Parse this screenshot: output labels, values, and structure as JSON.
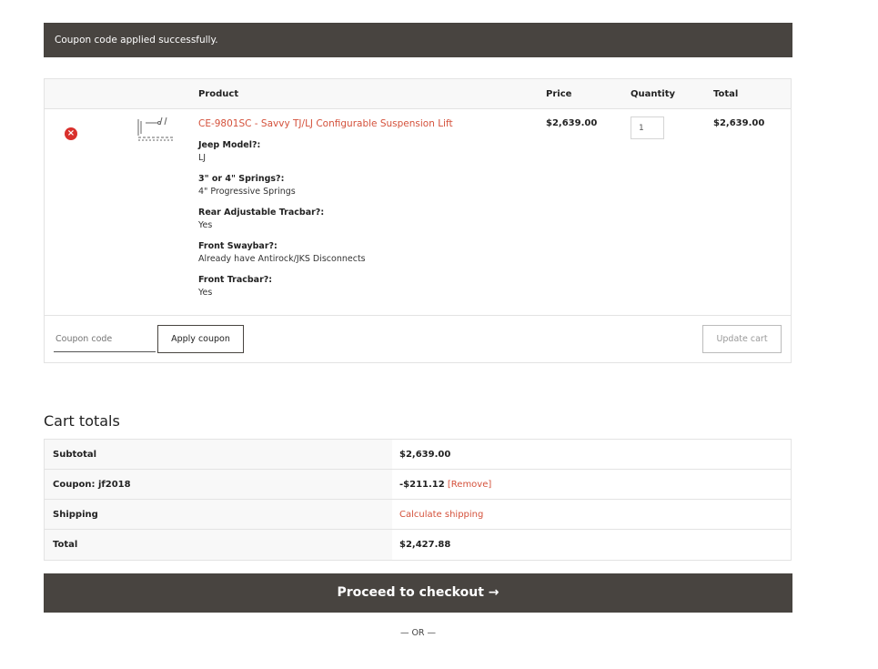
{
  "notice": {
    "message": "Coupon code applied successfully."
  },
  "cart": {
    "headers": {
      "product": "Product",
      "price": "Price",
      "quantity": "Quantity",
      "total": "Total"
    },
    "item": {
      "name": "CE-9801SC - Savvy TJ/LJ Configurable Suspension Lift",
      "price": "$2,639.00",
      "quantity": "1",
      "total": "$2,639.00",
      "meta": [
        {
          "key": "Jeep Model?:",
          "value": "LJ"
        },
        {
          "key": "3\" or 4\" Springs?:",
          "value": "4\" Progressive Springs"
        },
        {
          "key": "Rear Adjustable Tracbar?:",
          "value": "Yes"
        },
        {
          "key": "Front Swaybar?:",
          "value": "Already have Antirock/JKS Disconnects"
        },
        {
          "key": "Front Tracbar?:",
          "value": "Yes"
        }
      ]
    },
    "coupon_placeholder": "Coupon code",
    "apply_label": "Apply coupon",
    "update_label": "Update cart"
  },
  "totals": {
    "title": "Cart totals",
    "subtotal_label": "Subtotal",
    "subtotal_value": "$2,639.00",
    "coupon_label": "Coupon: jf2018",
    "coupon_value": "-$211.12",
    "coupon_remove": "[Remove]",
    "shipping_label": "Shipping",
    "shipping_value": "Calculate shipping",
    "total_label": "Total",
    "total_value": "$2,427.88"
  },
  "checkout": {
    "label": "Proceed to checkout",
    "arrow": "→"
  },
  "or_text": "— OR —",
  "colors": {
    "accent": "#d4513b",
    "dark": "#484440",
    "remove": "#d9302c"
  }
}
